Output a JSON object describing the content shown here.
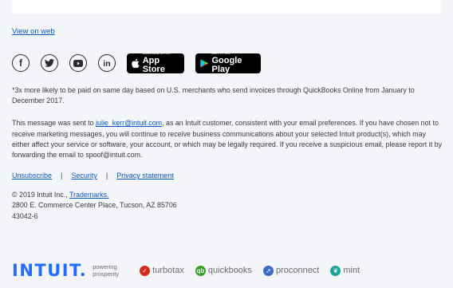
{
  "links": {
    "view_on_web": "View on web"
  },
  "social": {
    "icons": [
      "facebook-icon",
      "twitter-icon",
      "youtube-icon",
      "linkedin-icon"
    ]
  },
  "app_store": {
    "small": "Download on the",
    "big": "App Store"
  },
  "google_play": {
    "small": "GET IT ON",
    "big": "Google Play"
  },
  "disclaimer": "*3x more likely to be paid on same day based on U.S. merchants who send invoices through QuickBooks Online from January to December 2017.",
  "message": {
    "prefix": "This message was sent to ",
    "email": "julie_kerr@intuit.com",
    "suffix": ", as an Intuit customer, consistent with your email preferences. If you have chosen not to receive marketing messages, you will continue to receive business communications about your selected Intuit product(s), which may either affect your service or software, your account, or which may be legally required. If you receive a suspicious email, please report it by forwarding the email to spoof@intuit.com."
  },
  "footer_links": {
    "unsubscribe": "Unsubscribe",
    "security": "Security",
    "privacy": "Privacy statement",
    "separator": "|"
  },
  "copyright": {
    "line1_prefix": "© 2019 Intuit Inc., ",
    "trademarks": "Trademarks.",
    "line2": "2800 E. Commerce Center Place, Tucson, AZ 85706",
    "line3": "43042-6"
  },
  "brands": {
    "intuit": "INTUIT.",
    "tagline_1": "powering",
    "tagline_2": "prosperity",
    "turbotax": "turbotax",
    "quickbooks": "quickbooks",
    "proconnect": "proconnect",
    "mint": "mint"
  },
  "colors": {
    "link": "#0a58c7",
    "intuit_blue": "#236cff",
    "turbotax_red": "#d52b1e",
    "quickbooks_green": "#2ca01c",
    "proconnect_blue": "#3b6ac8",
    "mint_teal": "#17a398",
    "background": "#f4f5f8"
  }
}
